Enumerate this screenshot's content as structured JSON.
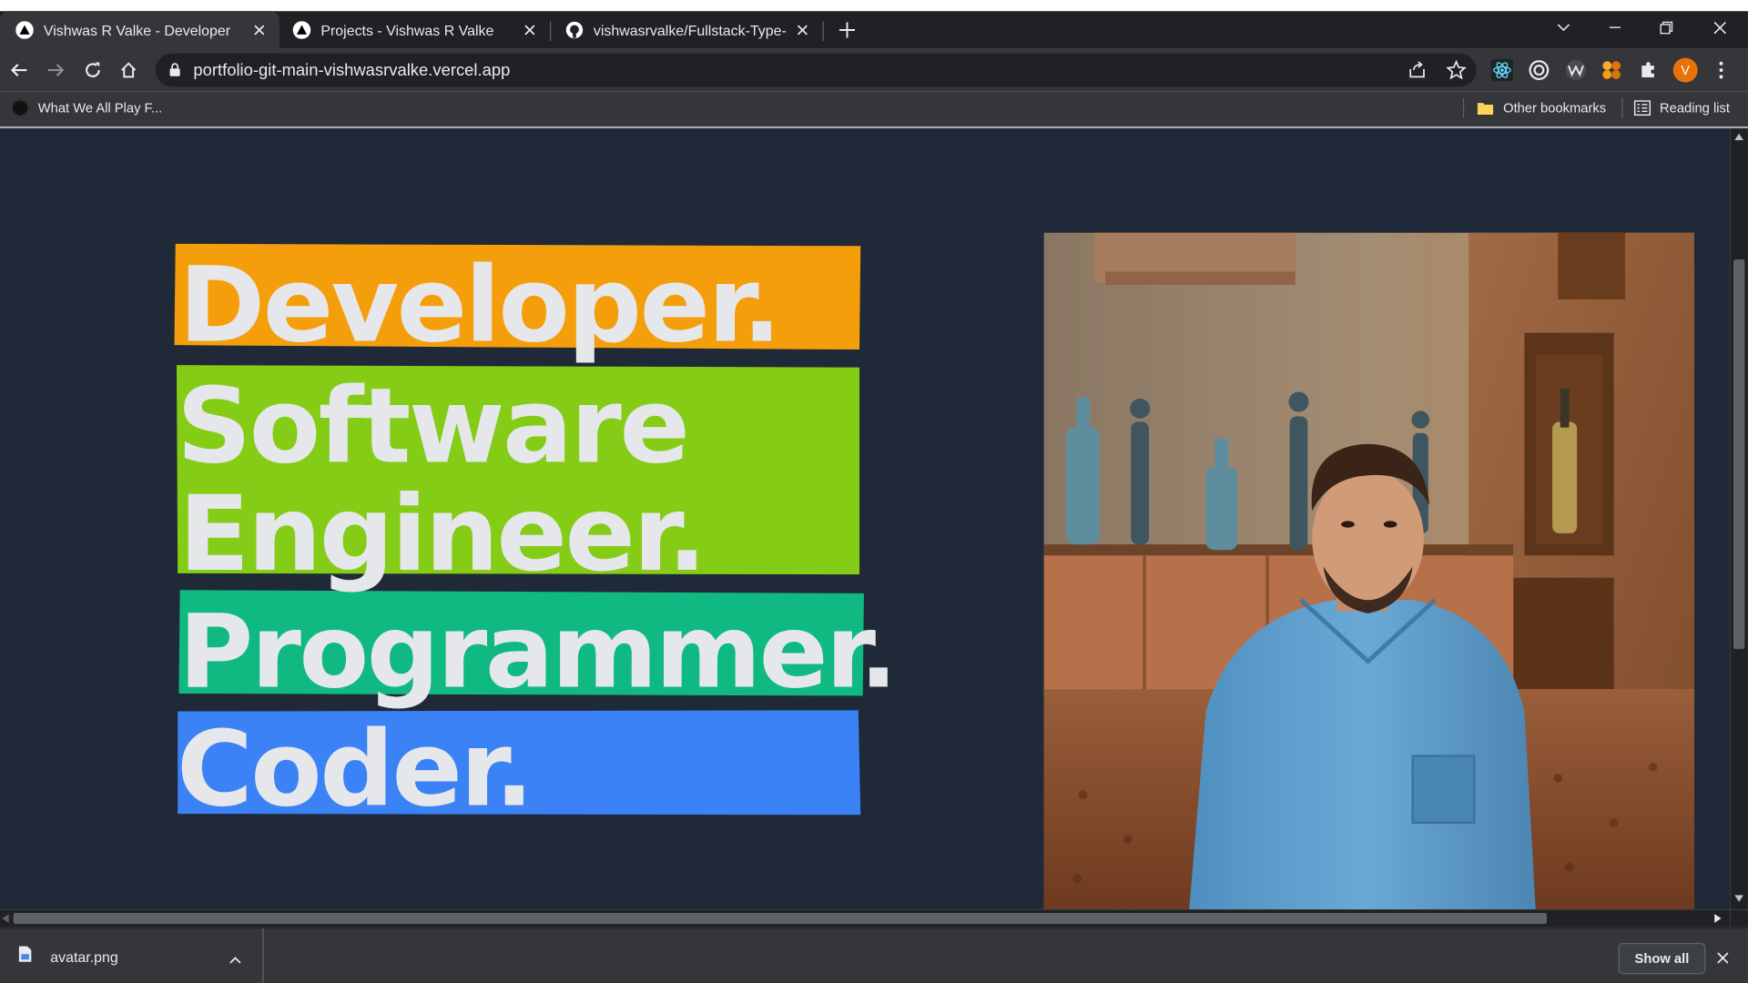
{
  "browser": {
    "tabs": [
      {
        "title": "Vishwas R Valke - Developer",
        "active": true,
        "icon": "vercel-triangle-icon"
      },
      {
        "title": "Projects - Vishwas R Valke",
        "active": false,
        "icon": "vercel-triangle-icon"
      },
      {
        "title": "vishwasrvalke/Fullstack-Type-gra",
        "active": false,
        "icon": "github-icon"
      }
    ],
    "address_bar": {
      "url": "portfolio-git-main-vishwasrvalke.vercel.app"
    },
    "profile_initial": "V",
    "bookmarks": {
      "items": [
        {
          "label": "What We All Play F...",
          "icon": "circle-favicon-icon"
        }
      ],
      "other_bookmarks": "Other bookmarks",
      "reading_list": "Reading list"
    }
  },
  "page": {
    "headline_lines": [
      {
        "text": "Developer.",
        "color": "#f59e0b"
      },
      {
        "text": "Software",
        "color": "#84cc16"
      },
      {
        "text": "Engineer.",
        "color": "#84cc16"
      },
      {
        "text": "Programmer.",
        "color": "#10b981"
      },
      {
        "text": "Coder.",
        "color": "#3b82f6"
      }
    ],
    "background_color": "#1f2937",
    "text_color": "#e5e7eb"
  },
  "downloads": {
    "file_name": "avatar.png",
    "show_all_label": "Show all"
  }
}
